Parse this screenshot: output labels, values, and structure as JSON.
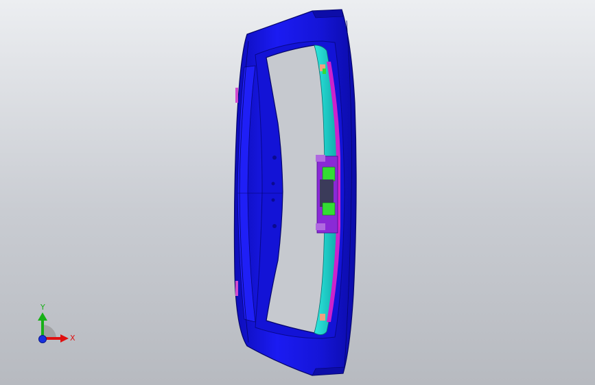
{
  "viewport": {
    "background_top": "#eceef1",
    "background_bottom": "#b7bac0"
  },
  "model": {
    "colors": {
      "frame": "#1a1aee",
      "frame_dark": "#0c0cb0",
      "frame_edge": "#05056a",
      "liner": "#22e0d8",
      "liner_dark": "#109c9c",
      "magenta": "#cc22cc",
      "purple": "#8a2ad6",
      "green": "#33dd33",
      "salmon": "#f0a080",
      "window": "#c5c8ce"
    }
  },
  "triad": {
    "x_label": "X",
    "y_label": "Y",
    "x_color": "#e01010",
    "y_color": "#18b018",
    "z_color": "#1830e0",
    "x_icon": "arrow-right-icon",
    "y_icon": "arrow-up-icon",
    "z_icon": "circle-dot-icon"
  }
}
